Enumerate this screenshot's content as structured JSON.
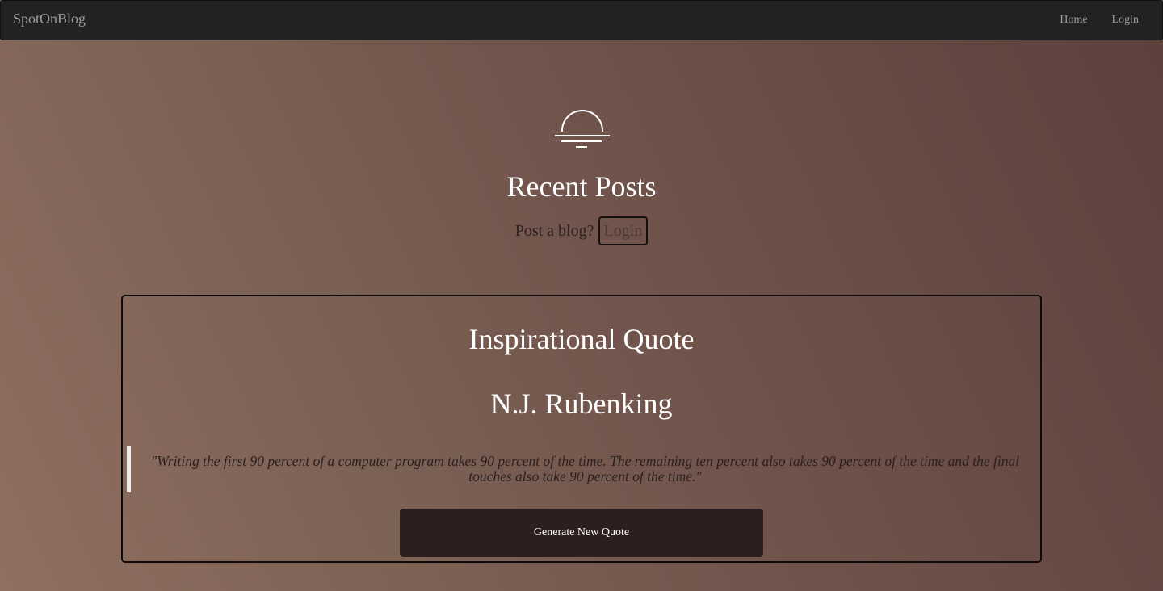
{
  "navbar": {
    "brand": "SpotOnBlog",
    "links": [
      "Home",
      "Login"
    ]
  },
  "hero": {
    "icon": "sunset-icon",
    "title": "Recent Posts",
    "prompt_text": "Post a blog?",
    "login_label": "Login"
  },
  "quote_card": {
    "heading": "Inspirational Quote",
    "author": "N.J. Rubenking",
    "text": "\"Writing the first 90 percent of a computer program takes 90 percent of the time. The remaining ten percent also takes 90 percent of the time and the final touches also take 90 percent of the time.\"",
    "button_label": "Generate New Quote"
  },
  "colors": {
    "navbar_bg": "#222222",
    "nav_text": "#9d9d9d",
    "button_bg": "#2d1f1f",
    "gradient_start": "#8f7062",
    "gradient_end": "#5c403c"
  }
}
